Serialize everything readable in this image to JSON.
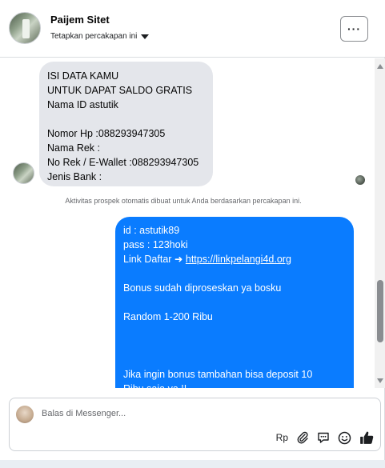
{
  "header": {
    "name": "Paijem Sitet",
    "subtitle": "Tetapkan percakapan ini",
    "more_label": "···"
  },
  "messages": {
    "incoming": {
      "text": "ISI DATA KAMU\nUNTUK DAPAT SALDO GRATIS\nNama ID astutik\n\nNomor Hp :088293947305\nNama Rek :\nNo Rek / E-Wallet :088293947305\nJenis Bank :"
    },
    "notice": "Aktivitas prospek otomatis dibuat untuk Anda berdasarkan percakapan ini.",
    "outgoing": {
      "line1": "id : astutik89",
      "line2": "pass : 123hoki",
      "link_prefix": "Link Daftar ➜ ",
      "link_text": "https://linkpelangi4d.org",
      "line4": "Bonus sudah diproseskan ya bosku",
      "line5": "Random 1-200 Ribu",
      "line6": "Jika ingin bonus tambahan bisa deposit 10",
      "line7": "Ribu saja ya !!"
    }
  },
  "composer": {
    "placeholder": "Balas di Messenger...",
    "currency_label": "Rp"
  },
  "icons": [
    "more-icon",
    "caret-down-icon",
    "attach-icon",
    "saved-replies-icon",
    "emoji-icon",
    "like-icon"
  ],
  "colors": {
    "outgoing_bubble": "#0a7cff",
    "incoming_bubble": "#e4e6eb",
    "like": "#1c1e21"
  }
}
